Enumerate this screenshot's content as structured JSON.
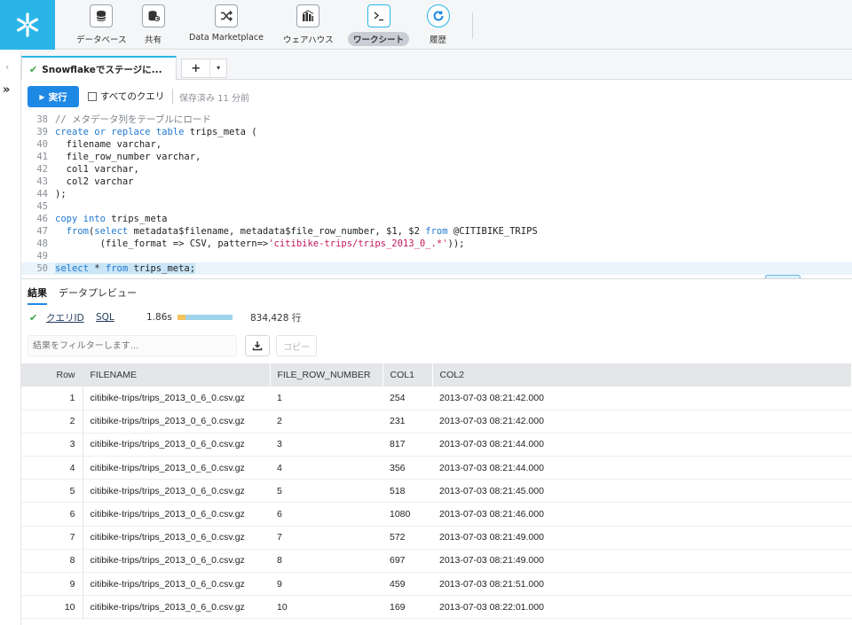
{
  "nav": {
    "items": [
      {
        "label": "データベース",
        "icon": "database-icon"
      },
      {
        "label": "共有",
        "icon": "shared-database-icon"
      },
      {
        "label": "Data Marketplace",
        "icon": "shuffle-icon"
      },
      {
        "label": "ウェアハウス",
        "icon": "warehouse-icon"
      },
      {
        "label": "ワークシート",
        "icon": "terminal-icon"
      },
      {
        "label": "履歴",
        "icon": "history-icon"
      }
    ]
  },
  "tabs": {
    "active_label": "Snowflakeでステージに...",
    "add_label": "+",
    "dropdown_label": "▾"
  },
  "toolbar": {
    "run_label": "実行",
    "all_queries_label": "すべてのクエリ",
    "saved_label": "保存済み 11 分前"
  },
  "editor": {
    "lines": [
      {
        "n": "38",
        "text": "// メタデータ列をテーブルにロード"
      },
      {
        "n": "39",
        "text": "create or replace table trips_meta ("
      },
      {
        "n": "40",
        "text": "  filename varchar,"
      },
      {
        "n": "41",
        "text": "  file_row_number varchar,"
      },
      {
        "n": "42",
        "text": "  col1 varchar,"
      },
      {
        "n": "43",
        "text": "  col2 varchar"
      },
      {
        "n": "44",
        "text": ");"
      },
      {
        "n": "45",
        "text": ""
      },
      {
        "n": "46",
        "text": "copy into trips_meta"
      },
      {
        "n": "47",
        "text": "  from(select metadata$filename, metadata$file_row_number, $1, $2 from @CITIBIKE_TRIPS"
      },
      {
        "n": "48",
        "text": "        (file_format => CSV, pattern=>'citibike-trips/trips_2013_0_.*'));"
      },
      {
        "n": "49",
        "text": ""
      },
      {
        "n": "50",
        "text": "select * from trips_meta;"
      }
    ]
  },
  "results": {
    "tabs": [
      "結果",
      "データプレビュー"
    ],
    "query_id_label": "クエリID",
    "sql_label": "SQL",
    "duration": "1.86s",
    "duration_split": 0.14,
    "row_count": "834,428 行",
    "filter_placeholder": "結果をフィルターします...",
    "copy_label": "コピー",
    "columns": [
      "Row",
      "FILENAME",
      "FILE_ROW_NUMBER",
      "COL1",
      "COL2"
    ],
    "rows": [
      [
        "1",
        "citibike-trips/trips_2013_0_6_0.csv.gz",
        "1",
        "254",
        "2013-07-03 08:21:42.000"
      ],
      [
        "2",
        "citibike-trips/trips_2013_0_6_0.csv.gz",
        "2",
        "231",
        "2013-07-03 08:21:42.000"
      ],
      [
        "3",
        "citibike-trips/trips_2013_0_6_0.csv.gz",
        "3",
        "817",
        "2013-07-03 08:21:44.000"
      ],
      [
        "4",
        "citibike-trips/trips_2013_0_6_0.csv.gz",
        "4",
        "356",
        "2013-07-03 08:21:44.000"
      ],
      [
        "5",
        "citibike-trips/trips_2013_0_6_0.csv.gz",
        "5",
        "518",
        "2013-07-03 08:21:45.000"
      ],
      [
        "6",
        "citibike-trips/trips_2013_0_6_0.csv.gz",
        "6",
        "1080",
        "2013-07-03 08:21:46.000"
      ],
      [
        "7",
        "citibike-trips/trips_2013_0_6_0.csv.gz",
        "7",
        "572",
        "2013-07-03 08:21:49.000"
      ],
      [
        "8",
        "citibike-trips/trips_2013_0_6_0.csv.gz",
        "8",
        "697",
        "2013-07-03 08:21:49.000"
      ],
      [
        "9",
        "citibike-trips/trips_2013_0_6_0.csv.gz",
        "9",
        "459",
        "2013-07-03 08:21:51.000"
      ],
      [
        "10",
        "citibike-trips/trips_2013_0_6_0.csv.gz",
        "10",
        "169",
        "2013-07-03 08:22:01.000"
      ]
    ]
  },
  "colors": {
    "brand": "#29b5e8",
    "run_button": "#1e88e5",
    "success": "#39a74a"
  }
}
